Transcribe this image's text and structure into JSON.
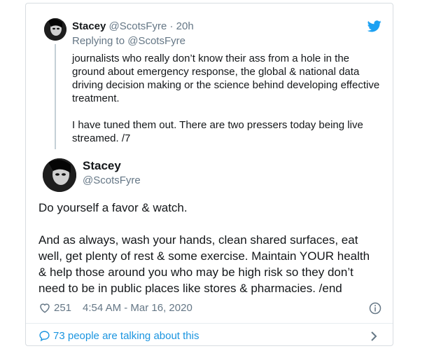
{
  "reply": {
    "name": "Stacey",
    "handle": "@ScotsFyre",
    "time": "· 20h",
    "replying_prefix": "Replying to ",
    "replying_handle": "@ScotsFyre",
    "text": "journalists who really don’t know their ass from a hole in the ground about emergency response, the global & national data driving decision making or the science behind developing effective treatment.\n\nI have tuned them out. There are two pressers today being live streamed. /7"
  },
  "tweet": {
    "name": "Stacey",
    "handle": "@ScotsFyre",
    "text": "Do yourself a favor & watch.\n\nAnd as always, wash your hands, clean shared surfaces, eat well, get plenty of rest & some exercise. Maintain YOUR health & help those around you who may be high risk so they don’t need to be in public places like stores & pharmacies. /end",
    "likes": "251",
    "timestamp": "4:54 AM - Mar 16, 2020"
  },
  "footer": {
    "talking": "73 people are talking about this"
  },
  "icons": {
    "brand": "twitter-bird-icon",
    "like": "heart-icon",
    "info": "info-icon",
    "talk": "speech-bubble-icon",
    "more": "chevron-right-icon"
  },
  "colors": {
    "accent": "#1da1f2",
    "link": "#1b95e0",
    "muted": "#657786",
    "text": "#14171a"
  }
}
